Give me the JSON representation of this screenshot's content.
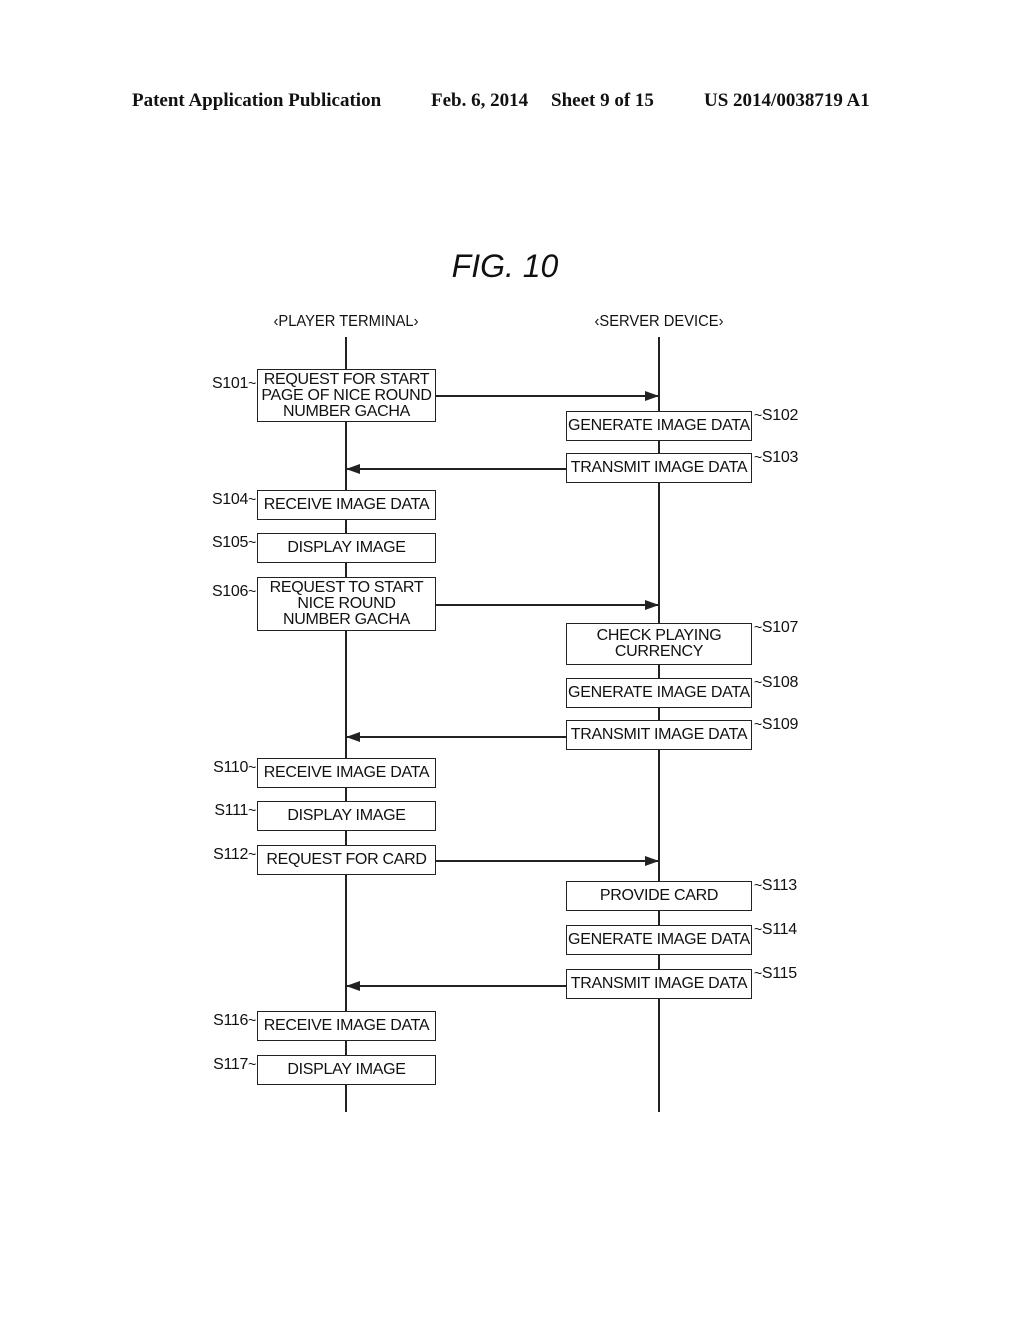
{
  "header": {
    "publication": "Patent Application Publication",
    "date": "Feb. 6, 2014",
    "sheet": "Sheet 9 of 15",
    "number": "US 2014/0038719 A1"
  },
  "figure": {
    "title": "FIG. 10",
    "lanes": {
      "player": "‹PLAYER TERMINAL›",
      "server": "‹SERVER DEVICE›"
    },
    "steps": [
      {
        "id": "S101",
        "lane": "player",
        "text": "REQUEST FOR START\nPAGE OF NICE ROUND\nNUMBER GACHA"
      },
      {
        "id": "S102",
        "lane": "server",
        "text": "GENERATE IMAGE DATA"
      },
      {
        "id": "S103",
        "lane": "server",
        "text": "TRANSMIT IMAGE DATA"
      },
      {
        "id": "S104",
        "lane": "player",
        "text": "RECEIVE IMAGE DATA"
      },
      {
        "id": "S105",
        "lane": "player",
        "text": "DISPLAY IMAGE"
      },
      {
        "id": "S106",
        "lane": "player",
        "text": "REQUEST TO START\nNICE ROUND\nNUMBER GACHA"
      },
      {
        "id": "S107",
        "lane": "server",
        "text": "CHECK PLAYING\nCURRENCY"
      },
      {
        "id": "S108",
        "lane": "server",
        "text": "GENERATE IMAGE DATA"
      },
      {
        "id": "S109",
        "lane": "server",
        "text": "TRANSMIT IMAGE DATA"
      },
      {
        "id": "S110",
        "lane": "player",
        "text": "RECEIVE IMAGE DATA"
      },
      {
        "id": "S111",
        "lane": "player",
        "text": "DISPLAY IMAGE"
      },
      {
        "id": "S112",
        "lane": "player",
        "text": "REQUEST FOR CARD"
      },
      {
        "id": "S113",
        "lane": "server",
        "text": "PROVIDE CARD"
      },
      {
        "id": "S114",
        "lane": "server",
        "text": "GENERATE IMAGE DATA"
      },
      {
        "id": "S115",
        "lane": "server",
        "text": "TRANSMIT IMAGE DATA"
      },
      {
        "id": "S116",
        "lane": "player",
        "text": "RECEIVE IMAGE DATA"
      },
      {
        "id": "S117",
        "lane": "player",
        "text": "DISPLAY IMAGE"
      }
    ],
    "messages": [
      {
        "from": "S101",
        "direction": "player-to-server"
      },
      {
        "from": "S103",
        "direction": "server-to-player"
      },
      {
        "from": "S106",
        "direction": "player-to-server"
      },
      {
        "from": "S109",
        "direction": "server-to-player"
      },
      {
        "from": "S112",
        "direction": "player-to-server"
      },
      {
        "from": "S115",
        "direction": "server-to-player"
      }
    ]
  }
}
